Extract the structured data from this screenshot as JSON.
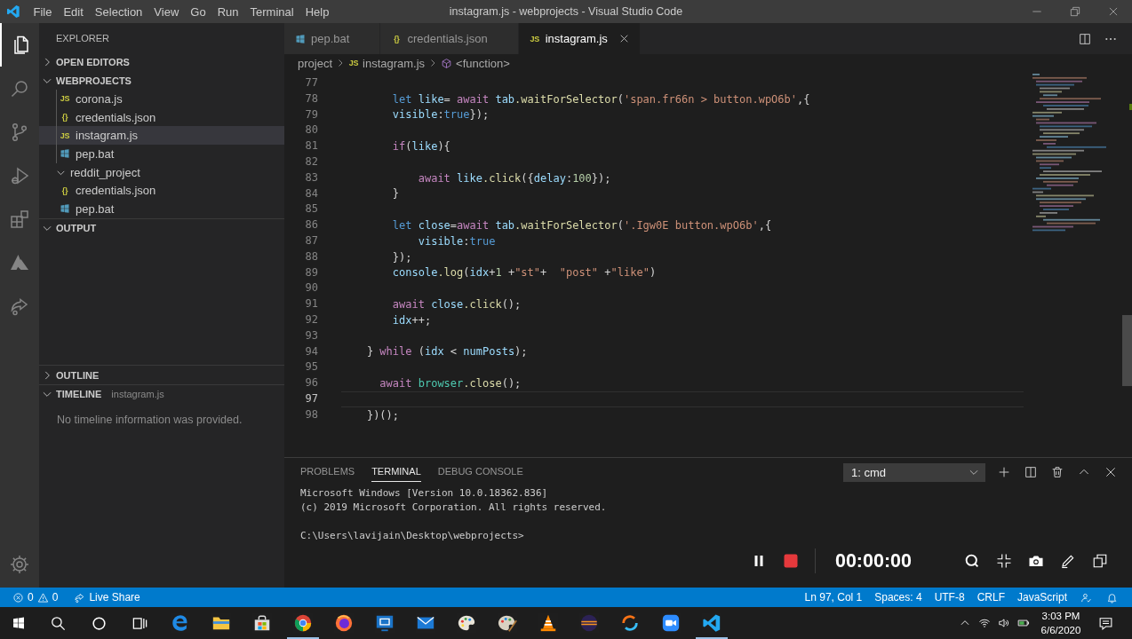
{
  "title_bar": {
    "menu": [
      "File",
      "Edit",
      "Selection",
      "View",
      "Go",
      "Run",
      "Terminal",
      "Help"
    ],
    "title": "instagram.js - webprojects - Visual Studio Code"
  },
  "activity_bar": {
    "items": [
      {
        "kind": "explorer",
        "selected": true
      },
      {
        "kind": "search",
        "selected": false
      },
      {
        "kind": "source-control",
        "selected": false
      },
      {
        "kind": "run",
        "selected": false
      },
      {
        "kind": "extensions",
        "selected": false
      },
      {
        "kind": "azure",
        "selected": false
      },
      {
        "kind": "live-share",
        "selected": false
      }
    ]
  },
  "sidebar": {
    "title": "EXPLORER",
    "sections": [
      {
        "kind": "open-editors",
        "label": "OPEN EDITORS",
        "expanded": false
      },
      {
        "kind": "folders",
        "label": "WEBPROJECTS",
        "expanded": true,
        "tree": [
          {
            "kind": "hidden-folder",
            "children": [
              {
                "kind": "js",
                "glyph": "JS",
                "name": "corona.js",
                "selected": false
              },
              {
                "kind": "json",
                "glyph": "{}",
                "name": "credentials.json",
                "selected": false
              },
              {
                "kind": "js",
                "glyph": "JS",
                "name": "instagram.js",
                "selected": true
              },
              {
                "kind": "bat",
                "name": "pep.bat",
                "selected": false
              }
            ]
          },
          {
            "kind": "folder",
            "name": "reddit_project",
            "expanded": true,
            "selected": false,
            "children": [
              {
                "kind": "json",
                "glyph": "{}",
                "name": "credentials.json",
                "selected": false
              },
              {
                "kind": "bat",
                "name": "pep.bat",
                "selected": false
              }
            ]
          }
        ]
      },
      {
        "kind": "output",
        "label": "OUTPUT",
        "expanded": true
      },
      {
        "kind": "outline",
        "label": "OUTLINE",
        "expanded": false
      },
      {
        "kind": "timeline",
        "label": "TIMELINE",
        "expanded": true,
        "detail": "instagram.js",
        "message": "No timeline information was provided."
      }
    ]
  },
  "editor": {
    "tabs": [
      {
        "kind": "bat",
        "label": "pep.bat",
        "selected": false
      },
      {
        "kind": "json",
        "glyph": "{}",
        "label": "credentials.json",
        "selected": false
      },
      {
        "kind": "js",
        "glyph": "JS",
        "label": "instagram.js",
        "selected": true
      }
    ],
    "breadcrumb": [
      {
        "kind": "folder",
        "label": "project"
      },
      {
        "kind": "js",
        "glyph": "JS",
        "label": "instagram.js"
      },
      {
        "kind": "symbol",
        "label": "<function>"
      }
    ],
    "lines": [
      {
        "number": "77",
        "current": false
      },
      {
        "number": "78",
        "current": false,
        "tokens": [
          {
            "kind": "kw",
            "text": "        let "
          },
          {
            "kind": "var",
            "text": "like"
          },
          {
            "kind": "plain",
            "text": "= "
          },
          {
            "kind": "ctrl",
            "text": "await "
          },
          {
            "kind": "var",
            "text": "tab"
          },
          {
            "kind": "fn",
            "text": ".waitForSelector"
          },
          {
            "kind": "plain",
            "text": "("
          },
          {
            "kind": "str",
            "text": "'span.fr66n > button.wpO6b'"
          },
          {
            "kind": "plain",
            "text": ",{"
          }
        ]
      },
      {
        "number": "79",
        "current": false,
        "tokens": [
          {
            "kind": "var",
            "text": "        visible"
          },
          {
            "kind": "plain",
            "text": ":"
          },
          {
            "kind": "kw",
            "text": "true"
          },
          {
            "kind": "plain",
            "text": "});"
          }
        ]
      },
      {
        "number": "80",
        "current": false
      },
      {
        "number": "81",
        "current": false,
        "tokens": [
          {
            "kind": "ctrl",
            "text": "        if"
          },
          {
            "kind": "plain",
            "text": "("
          },
          {
            "kind": "var",
            "text": "like"
          },
          {
            "kind": "plain",
            "text": "){"
          }
        ]
      },
      {
        "number": "82",
        "current": false
      },
      {
        "number": "83",
        "current": false,
        "tokens": [
          {
            "kind": "ctrl",
            "text": "            await "
          },
          {
            "kind": "var",
            "text": "like"
          },
          {
            "kind": "fn",
            "text": ".click"
          },
          {
            "kind": "plain",
            "text": "({"
          },
          {
            "kind": "var",
            "text": "delay"
          },
          {
            "kind": "plain",
            "text": ":"
          },
          {
            "kind": "num",
            "text": "100"
          },
          {
            "kind": "plain",
            "text": "});"
          }
        ]
      },
      {
        "number": "84",
        "current": false,
        "tokens": [
          {
            "kind": "plain",
            "text": "        }"
          }
        ]
      },
      {
        "number": "85",
        "current": false
      },
      {
        "number": "86",
        "current": false,
        "tokens": [
          {
            "kind": "kw",
            "text": "        let "
          },
          {
            "kind": "var",
            "text": "close"
          },
          {
            "kind": "plain",
            "text": "="
          },
          {
            "kind": "ctrl",
            "text": "await "
          },
          {
            "kind": "var",
            "text": "tab"
          },
          {
            "kind": "fn",
            "text": ".waitForSelector"
          },
          {
            "kind": "plain",
            "text": "("
          },
          {
            "kind": "str",
            "text": "'.Igw0E button.wpO6b'"
          },
          {
            "kind": "plain",
            "text": ",{"
          }
        ]
      },
      {
        "number": "87",
        "current": false,
        "tokens": [
          {
            "kind": "var",
            "text": "            visible"
          },
          {
            "kind": "plain",
            "text": ":"
          },
          {
            "kind": "kw",
            "text": "true"
          }
        ]
      },
      {
        "number": "88",
        "current": false,
        "tokens": [
          {
            "kind": "plain",
            "text": "        });"
          }
        ]
      },
      {
        "number": "89",
        "current": false,
        "tokens": [
          {
            "kind": "var",
            "text": "        console"
          },
          {
            "kind": "fn",
            "text": ".log"
          },
          {
            "kind": "plain",
            "text": "("
          },
          {
            "kind": "var",
            "text": "idx"
          },
          {
            "kind": "plain",
            "text": "+"
          },
          {
            "kind": "num",
            "text": "1"
          },
          {
            "kind": "plain",
            "text": " +"
          },
          {
            "kind": "str",
            "text": "\"st\""
          },
          {
            "kind": "plain",
            "text": "+  "
          },
          {
            "kind": "str",
            "text": "\"post\""
          },
          {
            "kind": "plain",
            "text": " +"
          },
          {
            "kind": "str",
            "text": "\"like\""
          },
          {
            "kind": "plain",
            "text": ")"
          }
        ]
      },
      {
        "number": "90",
        "current": false
      },
      {
        "number": "91",
        "current": false,
        "tokens": [
          {
            "kind": "ctrl",
            "text": "        await "
          },
          {
            "kind": "var",
            "text": "close"
          },
          {
            "kind": "fn",
            "text": ".click"
          },
          {
            "kind": "plain",
            "text": "();"
          }
        ]
      },
      {
        "number": "92",
        "current": false,
        "tokens": [
          {
            "kind": "var",
            "text": "        idx"
          },
          {
            "kind": "plain",
            "text": "++;"
          }
        ]
      },
      {
        "number": "93",
        "current": false
      },
      {
        "number": "94",
        "current": false,
        "tokens": [
          {
            "kind": "plain",
            "text": "    } "
          },
          {
            "kind": "ctrl",
            "text": "while"
          },
          {
            "kind": "plain",
            "text": " ("
          },
          {
            "kind": "var",
            "text": "idx"
          },
          {
            "kind": "plain",
            "text": " < "
          },
          {
            "kind": "var",
            "text": "numPosts"
          },
          {
            "kind": "plain",
            "text": ");"
          }
        ]
      },
      {
        "number": "95",
        "current": false
      },
      {
        "number": "96",
        "current": false,
        "tokens": [
          {
            "kind": "ctrl",
            "text": "      await "
          },
          {
            "kind": "type",
            "text": "browser"
          },
          {
            "kind": "fn",
            "text": ".close"
          },
          {
            "kind": "plain",
            "text": "();"
          }
        ]
      },
      {
        "number": "97",
        "current": true
      },
      {
        "number": "98",
        "current": false,
        "tokens": [
          {
            "kind": "plain",
            "text": "    })();"
          }
        ]
      }
    ]
  },
  "panel": {
    "tabs": [
      {
        "label": "PROBLEMS",
        "selected": false
      },
      {
        "label": "TERMINAL",
        "selected": true
      },
      {
        "label": "DEBUG CONSOLE",
        "selected": false
      }
    ],
    "terminal_select": "1: cmd",
    "terminal_output": [
      "Microsoft Windows [Version 10.0.18362.836]",
      "(c) 2019 Microsoft Corporation. All rights reserved."
    ],
    "terminal_prompt": "C:\\Users\\lavijain\\Desktop\\webprojects>"
  },
  "recorder": {
    "timer": "00:00:00"
  },
  "status_bar": {
    "errors": "0",
    "warnings": "0",
    "live_share": "Live Share",
    "items": [
      "Ln 97, Col 1",
      "Spaces: 4",
      "UTF-8",
      "CRLF",
      "JavaScript"
    ]
  },
  "taskbar": {
    "apps": [
      {
        "kind": "edge",
        "running": false
      },
      {
        "kind": "files",
        "running": false
      },
      {
        "kind": "store",
        "running": false
      },
      {
        "kind": "chrome",
        "running": true
      },
      {
        "kind": "firefox",
        "running": false
      },
      {
        "kind": "remote",
        "running": false
      },
      {
        "kind": "mail",
        "running": false
      },
      {
        "kind": "paint3d",
        "running": false
      },
      {
        "kind": "paint",
        "running": false
      },
      {
        "kind": "vlc",
        "running": false
      },
      {
        "kind": "eclipse",
        "running": false
      },
      {
        "kind": "ring",
        "running": false
      },
      {
        "kind": "zoom",
        "running": false
      },
      {
        "kind": "vscode",
        "running": true
      }
    ],
    "time": "3:03 PM",
    "date": "6/6/2020"
  }
}
